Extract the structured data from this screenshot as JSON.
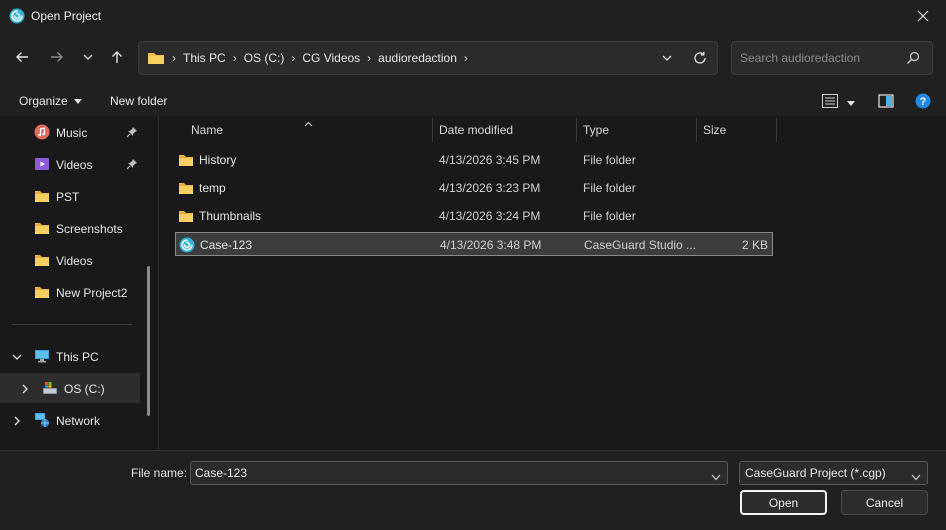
{
  "window": {
    "title": "Open Project",
    "app_icon": "caseguard-logo-icon",
    "close_icon": "close-icon"
  },
  "nav_buttons": {
    "back": "arrow-left-icon",
    "forward": "arrow-right-icon",
    "recent": "chevron-down-icon",
    "up": "arrow-up-icon"
  },
  "address": {
    "icon": "folder-icon",
    "crumbs": [
      "This PC",
      "OS (C:)",
      "CG Videos",
      "audioredaction"
    ]
  },
  "search": {
    "placeholder": "Search audioredaction"
  },
  "toolbar": {
    "organize_label": "Organize",
    "new_folder_label": "New folder"
  },
  "navpane": {
    "quick_items": [
      {
        "label": "Music",
        "icon": "music-icon",
        "pinned": true
      },
      {
        "label": "Videos",
        "icon": "videos-icon",
        "pinned": true
      },
      {
        "label": "PST",
        "icon": "folder-icon",
        "pinned": false
      },
      {
        "label": "Screenshots",
        "icon": "folder-icon",
        "pinned": false
      },
      {
        "label": "Videos",
        "icon": "folder-icon",
        "pinned": false
      },
      {
        "label": "New Project2",
        "icon": "folder-icon",
        "pinned": false
      }
    ],
    "tree_items": [
      {
        "label": "This PC",
        "icon": "pc-icon",
        "expanded": true
      },
      {
        "label": "OS (C:)",
        "icon": "drive-icon",
        "expanded": false,
        "selected": true
      },
      {
        "label": "Network",
        "icon": "network-icon",
        "expanded": false
      }
    ]
  },
  "filelist": {
    "columns": {
      "name": "Name",
      "date": "Date modified",
      "type": "Type",
      "size": "Size"
    },
    "rows": [
      {
        "name": "History",
        "date": "4/13/2026 3:45 PM",
        "type": "File folder",
        "size": "",
        "icon": "folder-icon"
      },
      {
        "name": "temp",
        "date": "4/13/2026 3:23 PM",
        "type": "File folder",
        "size": "",
        "icon": "folder-icon"
      },
      {
        "name": "Thumbnails",
        "date": "4/13/2026 3:24 PM",
        "type": "File folder",
        "size": "",
        "icon": "folder-icon"
      },
      {
        "name": "Case-123",
        "date": "4/13/2026 3:48 PM",
        "type": "CaseGuard Studio ...",
        "size": "2 KB",
        "icon": "caseguard-file-icon",
        "selected": true
      }
    ]
  },
  "bottom": {
    "file_name_label": "File name:",
    "file_name_value": "Case-123",
    "file_type_value": "CaseGuard Project (*.cgp)",
    "open_label": "Open",
    "cancel_label": "Cancel"
  },
  "colors": {
    "background": "#191919",
    "chrome": "#202020",
    "folder": "#f4c04a",
    "accent": "#3aa0e0",
    "help": "#1e88e5"
  }
}
